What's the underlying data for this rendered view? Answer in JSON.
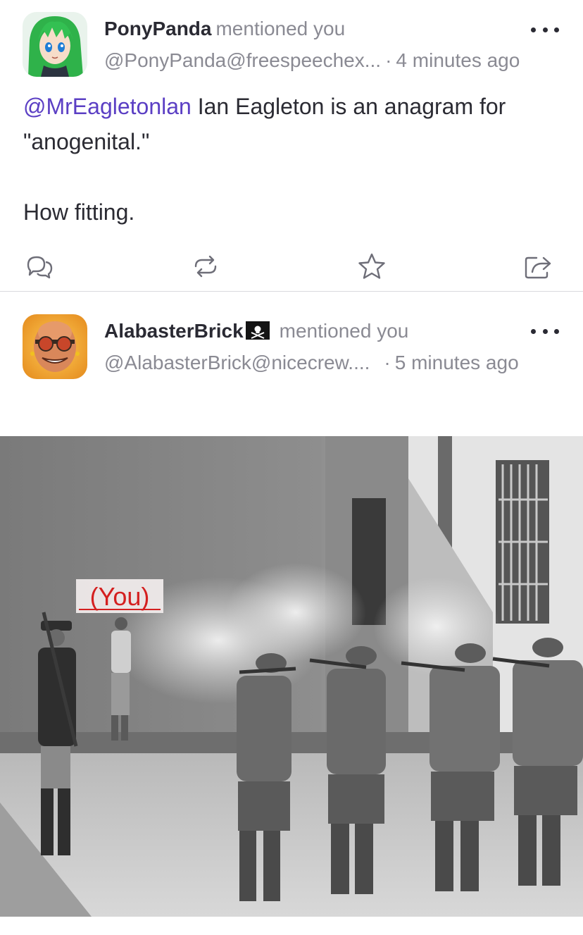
{
  "notifications": [
    {
      "display_name": "PonyPanda",
      "action_text": "mentioned you",
      "handle": "@PonyPanda@freespeechex...",
      "separator": "·",
      "time": "4 minutes ago",
      "content": {
        "mention": "@MrEagletonlan",
        "line1_rest": " Ian Eagleton is an anagram for",
        "line2": "\"anogenital.\"",
        "line3": "How fitting."
      },
      "avatar_icon": "anime-girl-green-hair-avatar"
    },
    {
      "display_name": "AlabasterBrick",
      "action_text": "mentioned you",
      "handle": "@AlabasterBrick@nicecrew....",
      "separator": "·",
      "time": "5 minutes ago",
      "avatar_icon": "bald-man-sunglasses-avatar",
      "badge_icon": "pirate-flag-icon",
      "media": {
        "overlay_label": "(You)"
      }
    }
  ],
  "actions": [
    "reply-icon",
    "boost-icon",
    "favourite-icon",
    "share-icon"
  ],
  "colors": {
    "mention": "#5b3fc4",
    "muted_text": "#8a8a93",
    "text": "#2b2b33",
    "divider": "#d9d9de"
  }
}
